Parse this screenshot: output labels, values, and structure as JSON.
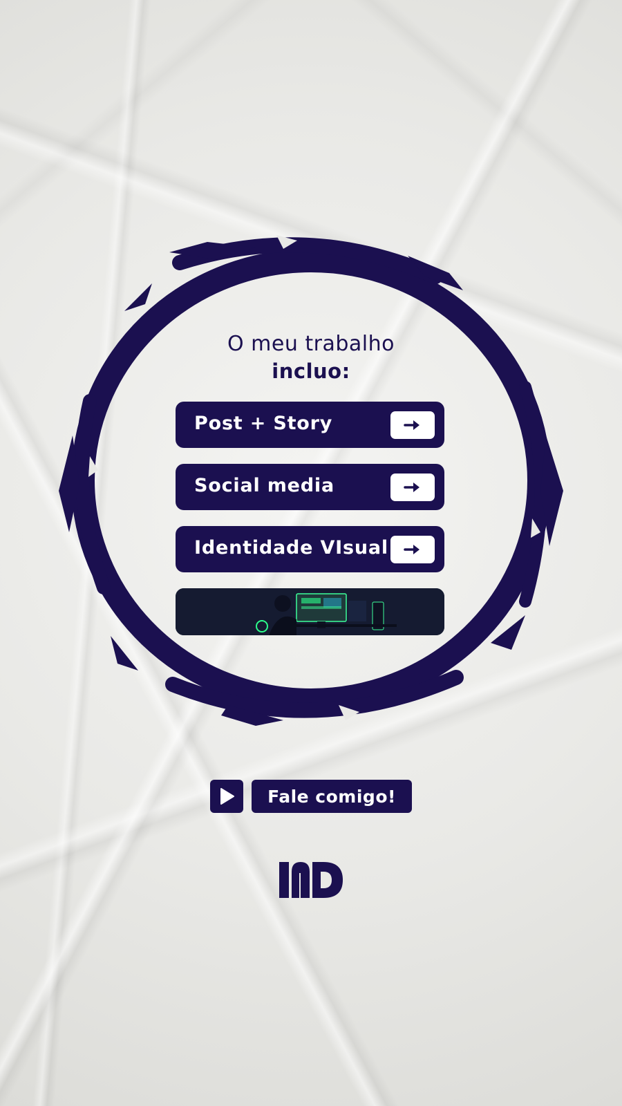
{
  "colors": {
    "brand_navy": "#1b1050",
    "paper": "#e9e9e6",
    "white": "#ffffff"
  },
  "heading": {
    "line1": "O meu trabalho",
    "line2": "incluo:"
  },
  "services": [
    {
      "label": "Post + Story",
      "icon": "arrow-right-icon"
    },
    {
      "label": "Social media",
      "icon": "arrow-right-icon"
    },
    {
      "label": "Identidade VIsual",
      "icon": "arrow-right-icon"
    }
  ],
  "media": {
    "description_icon": "gaming-setup-photo"
  },
  "cta": {
    "icon": "play-icon",
    "label": "Fale comigo!"
  },
  "logo": {
    "text": "MD"
  }
}
